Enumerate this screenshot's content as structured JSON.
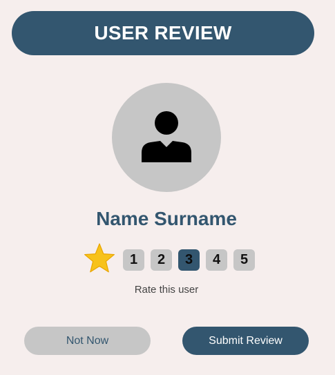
{
  "header": {
    "title": "USER REVIEW"
  },
  "profile": {
    "avatar_icon": "person-icon",
    "name": "Name Surname"
  },
  "rating": {
    "star_icon": "star-icon",
    "options": [
      "1",
      "2",
      "3",
      "4",
      "5"
    ],
    "selected": "3",
    "label": "Rate this user"
  },
  "actions": {
    "secondary_label": "Not Now",
    "primary_label": "Submit Review"
  },
  "colors": {
    "background": "#f6eeed",
    "primary": "#33566f",
    "neutral": "#c6c6c6",
    "star": "#f7c21b"
  }
}
